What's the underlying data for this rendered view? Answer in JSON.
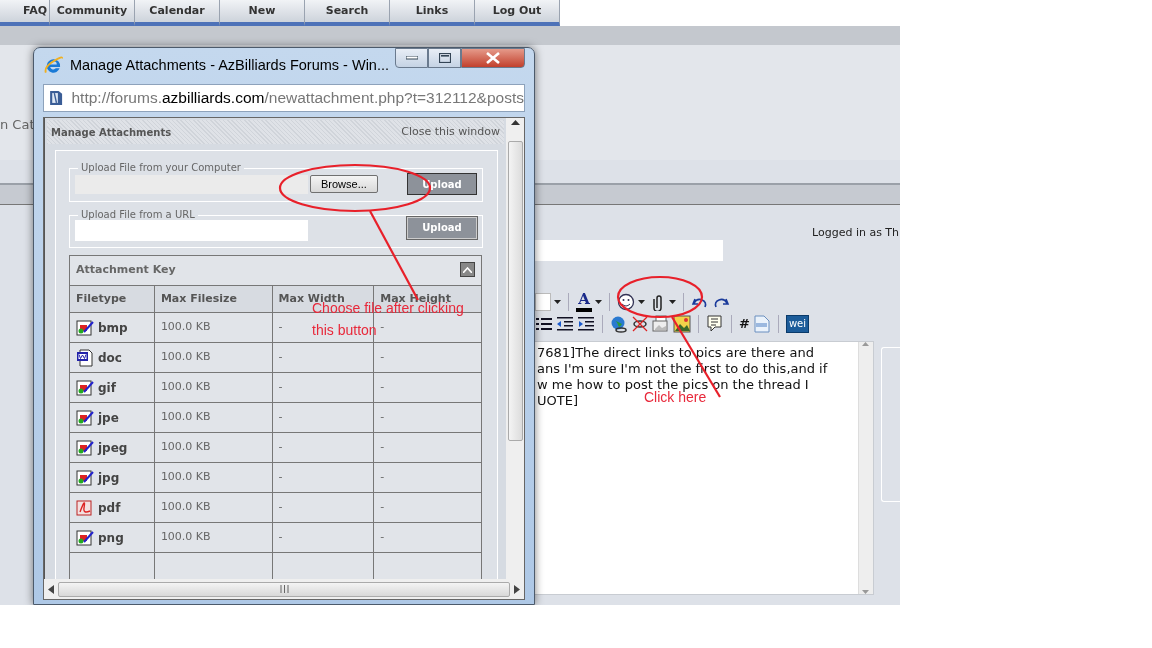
{
  "forum_nav": {
    "tabs": [
      {
        "label": "FAQ"
      },
      {
        "label": "Community"
      },
      {
        "label": "Calendar"
      },
      {
        "label": "New"
      },
      {
        "label": "Search"
      },
      {
        "label": "Links"
      },
      {
        "label": "Log Out"
      }
    ]
  },
  "forum_page": {
    "category_fragment": "n Cat",
    "logged_in": "Logged in as Th",
    "toolbar_rows": [
      [
        {
          "kind": "select"
        },
        {
          "kind": "caret"
        },
        {
          "kind": "sep"
        },
        {
          "kind": "font-color",
          "label": "A"
        },
        {
          "kind": "caret"
        },
        {
          "kind": "sep"
        },
        {
          "kind": "smiley"
        },
        {
          "kind": "caret"
        },
        {
          "kind": "paperclip"
        },
        {
          "kind": "caret"
        },
        {
          "kind": "sep"
        },
        {
          "kind": "undo"
        },
        {
          "kind": "redo"
        }
      ],
      [
        {
          "kind": "list"
        },
        {
          "kind": "outdent"
        },
        {
          "kind": "indent"
        },
        {
          "kind": "sep"
        },
        {
          "kind": "globe"
        },
        {
          "kind": "unlink"
        },
        {
          "kind": "image"
        },
        {
          "kind": "picture"
        },
        {
          "kind": "sep"
        },
        {
          "kind": "quote"
        },
        {
          "kind": "sep"
        },
        {
          "kind": "hash",
          "label": "#"
        },
        {
          "kind": "php"
        },
        {
          "kind": "sep"
        },
        {
          "kind": "tag",
          "label": "wei"
        }
      ]
    ],
    "editor_lines": [
      "7681]The direct links to pics are there and",
      "ans I'm sure I'm not the first to do this,and if",
      "w me how to post the pics on the thread I",
      "UOTE]"
    ]
  },
  "popup": {
    "title": "Manage Attachments - AzBilliards Forums - Win...",
    "address": {
      "prefix": "http://forums.",
      "domain": "azbilliards.com",
      "path": "/newattachment.php?t=312112&posts"
    },
    "header": "Manage Attachments",
    "close_link": "Close this window",
    "upload_computer": {
      "legend": "Upload File from your Computer",
      "browse": "Browse...",
      "upload": "Upload"
    },
    "upload_url": {
      "legend": "Upload File from a URL",
      "upload": "Upload"
    },
    "key": {
      "title": "Attachment Key",
      "columns": [
        "Filetype",
        "Max Filesize",
        "Max Width",
        "Max Height"
      ],
      "rows": [
        {
          "kind": "image",
          "filetype": "bmp",
          "max_filesize": "100.0 KB",
          "max_width": "-",
          "max_height": "-"
        },
        {
          "kind": "word",
          "filetype": "doc",
          "max_filesize": "100.0 KB",
          "max_width": "-",
          "max_height": "-"
        },
        {
          "kind": "image",
          "filetype": "gif",
          "max_filesize": "100.0 KB",
          "max_width": "-",
          "max_height": "-"
        },
        {
          "kind": "image",
          "filetype": "jpe",
          "max_filesize": "100.0 KB",
          "max_width": "-",
          "max_height": "-"
        },
        {
          "kind": "image",
          "filetype": "jpeg",
          "max_filesize": "100.0 KB",
          "max_width": "-",
          "max_height": "-"
        },
        {
          "kind": "image",
          "filetype": "jpg",
          "max_filesize": "100.0 KB",
          "max_width": "-",
          "max_height": "-"
        },
        {
          "kind": "pdf",
          "filetype": "pdf",
          "max_filesize": "100.0 KB",
          "max_width": "-",
          "max_height": "-"
        },
        {
          "kind": "image",
          "filetype": "png",
          "max_filesize": "100.0 KB",
          "max_width": "-",
          "max_height": "-"
        }
      ]
    }
  },
  "annotations": [
    {
      "lines": [
        "Choose file after clicking",
        "this button"
      ]
    },
    {
      "lines": [
        "Click here"
      ]
    }
  ]
}
